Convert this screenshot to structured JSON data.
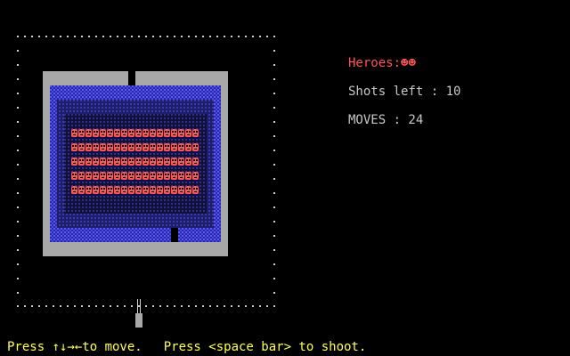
{
  "hud": {
    "heroes_label": "Heroes:",
    "heroes_icons": "☻☻",
    "shots_text": "Shots left : 10",
    "moves_text": "MOVES : 24"
  },
  "instructions": {
    "move": "Press ↑↓→←to move.",
    "shoot": "Press <space bar> to shoot."
  },
  "game": {
    "enemy_rows": 5,
    "enemies_per_row": 18,
    "enemy_glyph": "☻",
    "colors": {
      "wall_gray": "#a8a8a8",
      "moat_blue": "#3c3cd6",
      "inner_dark": "#1a1a4a",
      "enemy_red": "#ff5555",
      "dot_white": "#d0d0d0",
      "text_gray": "#c8c8c8",
      "text_yellow": "#ffff55"
    },
    "icons": [
      "player-cannon-icon",
      "hero-icon",
      "enemy-icon"
    ]
  }
}
